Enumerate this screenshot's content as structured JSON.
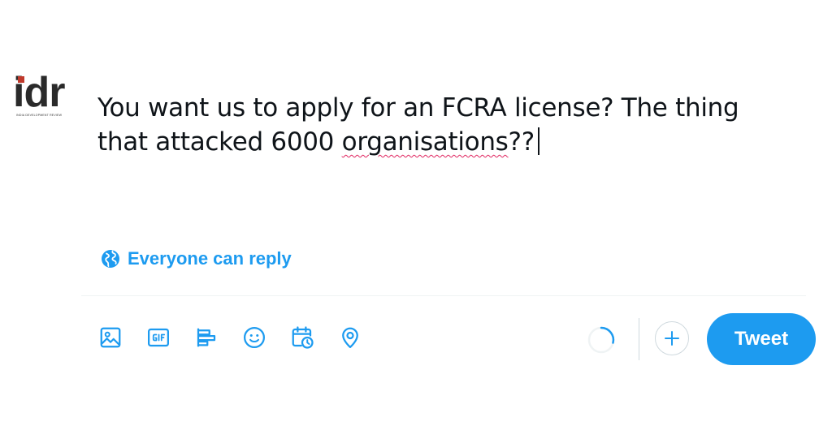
{
  "avatar": {
    "brand": "idr",
    "tagline": "India Development Review"
  },
  "composer": {
    "text_before": "You want us to apply for an FCRA license? The thing that attacked 6000 ",
    "misspelled_word": "organisations",
    "text_after": "??"
  },
  "reply_setting": {
    "icon": "globe-icon",
    "label": "Everyone can reply"
  },
  "toolbar": {
    "icons": [
      "image-icon",
      "gif-icon",
      "poll-icon",
      "emoji-icon",
      "schedule-icon",
      "location-icon"
    ]
  },
  "actions": {
    "tweet_label": "Tweet",
    "add_icon": "plus-icon"
  },
  "colors": {
    "accent": "#1d9bf0",
    "text": "#0f1419",
    "misspelling_underline": "#e0245e",
    "brand_dot": "#c0392b"
  }
}
